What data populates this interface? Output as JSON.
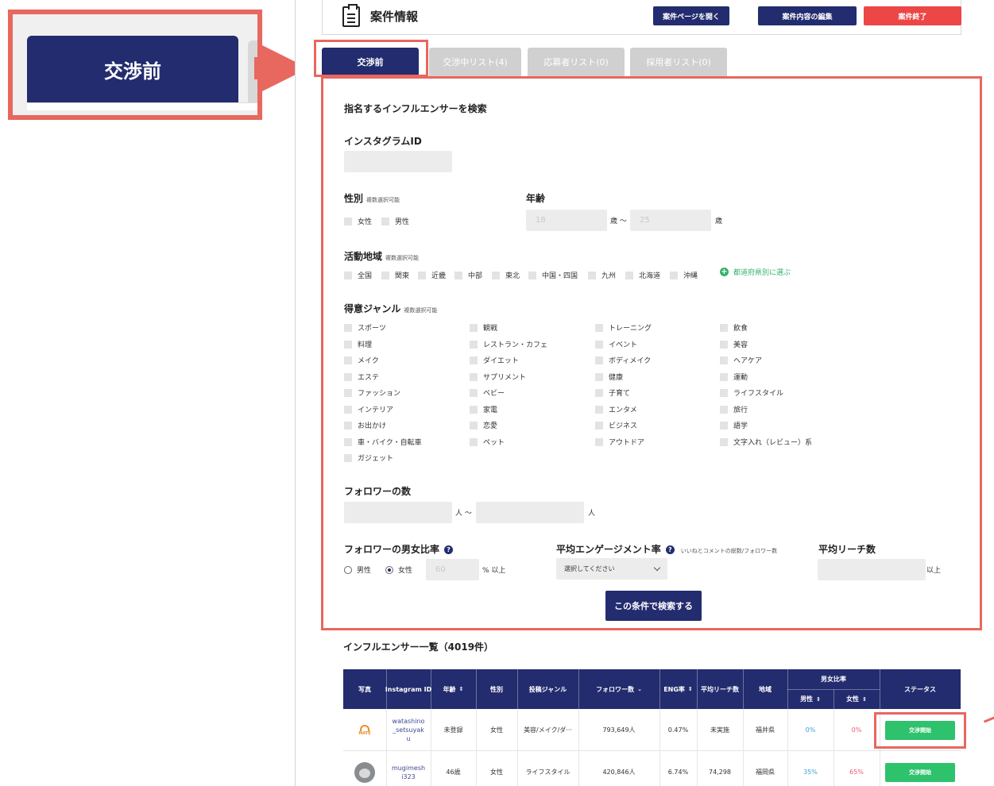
{
  "callout": {
    "tab_label": "交渉前"
  },
  "header": {
    "title": "案件情報",
    "btn_open": "案件ページを開く",
    "btn_edit": "案件内容の編集",
    "btn_end": "案件終了"
  },
  "tabs": [
    {
      "label": "交渉前"
    },
    {
      "label": "交渉中リスト(4)"
    },
    {
      "label": "応募者リスト(0)"
    },
    {
      "label": "採用者リスト(0)"
    }
  ],
  "search": {
    "heading": "指名するインフルエンサーを検索",
    "instagram_label": "インスタグラムID",
    "gender_label": "性別",
    "multi_note": "複数選択可能",
    "gender_options": [
      "女性",
      "男性"
    ],
    "age_label": "年齢",
    "age_min": "18",
    "age_max": "25",
    "age_unit_tilde": "歳 〜",
    "age_unit": "歳",
    "region_label": "活動地域",
    "regions": [
      "全国",
      "関東",
      "近畿",
      "中部",
      "東北",
      "中国・四国",
      "九州",
      "北海道",
      "沖縄"
    ],
    "prefecture_link": "都道府県別に選ぶ",
    "genre_label": "得意ジャンル",
    "genres_col1": [
      "スポーツ",
      "料理",
      "メイク",
      "エステ",
      "ファッション",
      "インテリア",
      "お出かけ",
      "車・バイク・自転車",
      "ガジェット"
    ],
    "genres_col2": [
      "観戦",
      "レストラン・カフェ",
      "ダイエット",
      "サプリメント",
      "ベビー",
      "家電",
      "恋愛",
      "ペット"
    ],
    "genres_col3": [
      "トレーニング",
      "イベント",
      "ボディメイク",
      "健康",
      "子育て",
      "エンタメ",
      "ビジネス",
      "アウトドア"
    ],
    "genres_col4": [
      "飲食",
      "美容",
      "ヘアケア",
      "運動",
      "ライフスタイル",
      "旅行",
      "語学",
      "文字入れ（レビュー）系"
    ],
    "followers_label": "フォロワーの数",
    "followers_unit_tilde": "人 〜",
    "followers_unit": "人",
    "ratio_label": "フォロワーの男女比率",
    "ratio_male": "男性",
    "ratio_female": "女性",
    "ratio_value": "60",
    "ratio_unit": "% 以上",
    "engagement_label": "平均エンゲージメント率",
    "engagement_note": "いいねとコメントの総数/フォロワー数",
    "engagement_select": "選択してください",
    "reach_label": "平均リーチ数",
    "reach_unit": "以上",
    "submit": "この条件で検索する"
  },
  "list": {
    "title": "インフルエンサー一覧（4019件）",
    "headers": {
      "photo": "写真",
      "instagram": "Instagram ID",
      "age": "年齢",
      "gender": "性別",
      "genre": "投稿ジャンル",
      "followers": "フォロワー数",
      "eng": "ENG率",
      "reach": "平均リーチ数",
      "region": "地域",
      "ratio": "男女比率",
      "male": "男性",
      "female": "女性",
      "status": "ステータス"
    },
    "rows": [
      {
        "avatar_text": "MATE",
        "id": "watashino_setsuyaku",
        "age": "未登録",
        "gender": "女性",
        "genre": "美容/メイク/ダ···",
        "followers": "793,649人",
        "eng": "0.47%",
        "reach": "未実施",
        "region": "福井県",
        "male": "0%",
        "female": "0%",
        "status": "交渉開始"
      },
      {
        "avatar_text": "",
        "id": "mugimeshi323",
        "age": "46歳",
        "gender": "女性",
        "genre": "ライフスタイル",
        "followers": "420,846人",
        "eng": "6.74%",
        "reach": "74,298",
        "region": "福岡県",
        "male": "35%",
        "female": "65%",
        "status": "交渉開始"
      }
    ]
  },
  "colors": {
    "navy": "#232c6e",
    "accent": "#e8675f",
    "green": "#2ec26d",
    "red": "#ec4646"
  }
}
